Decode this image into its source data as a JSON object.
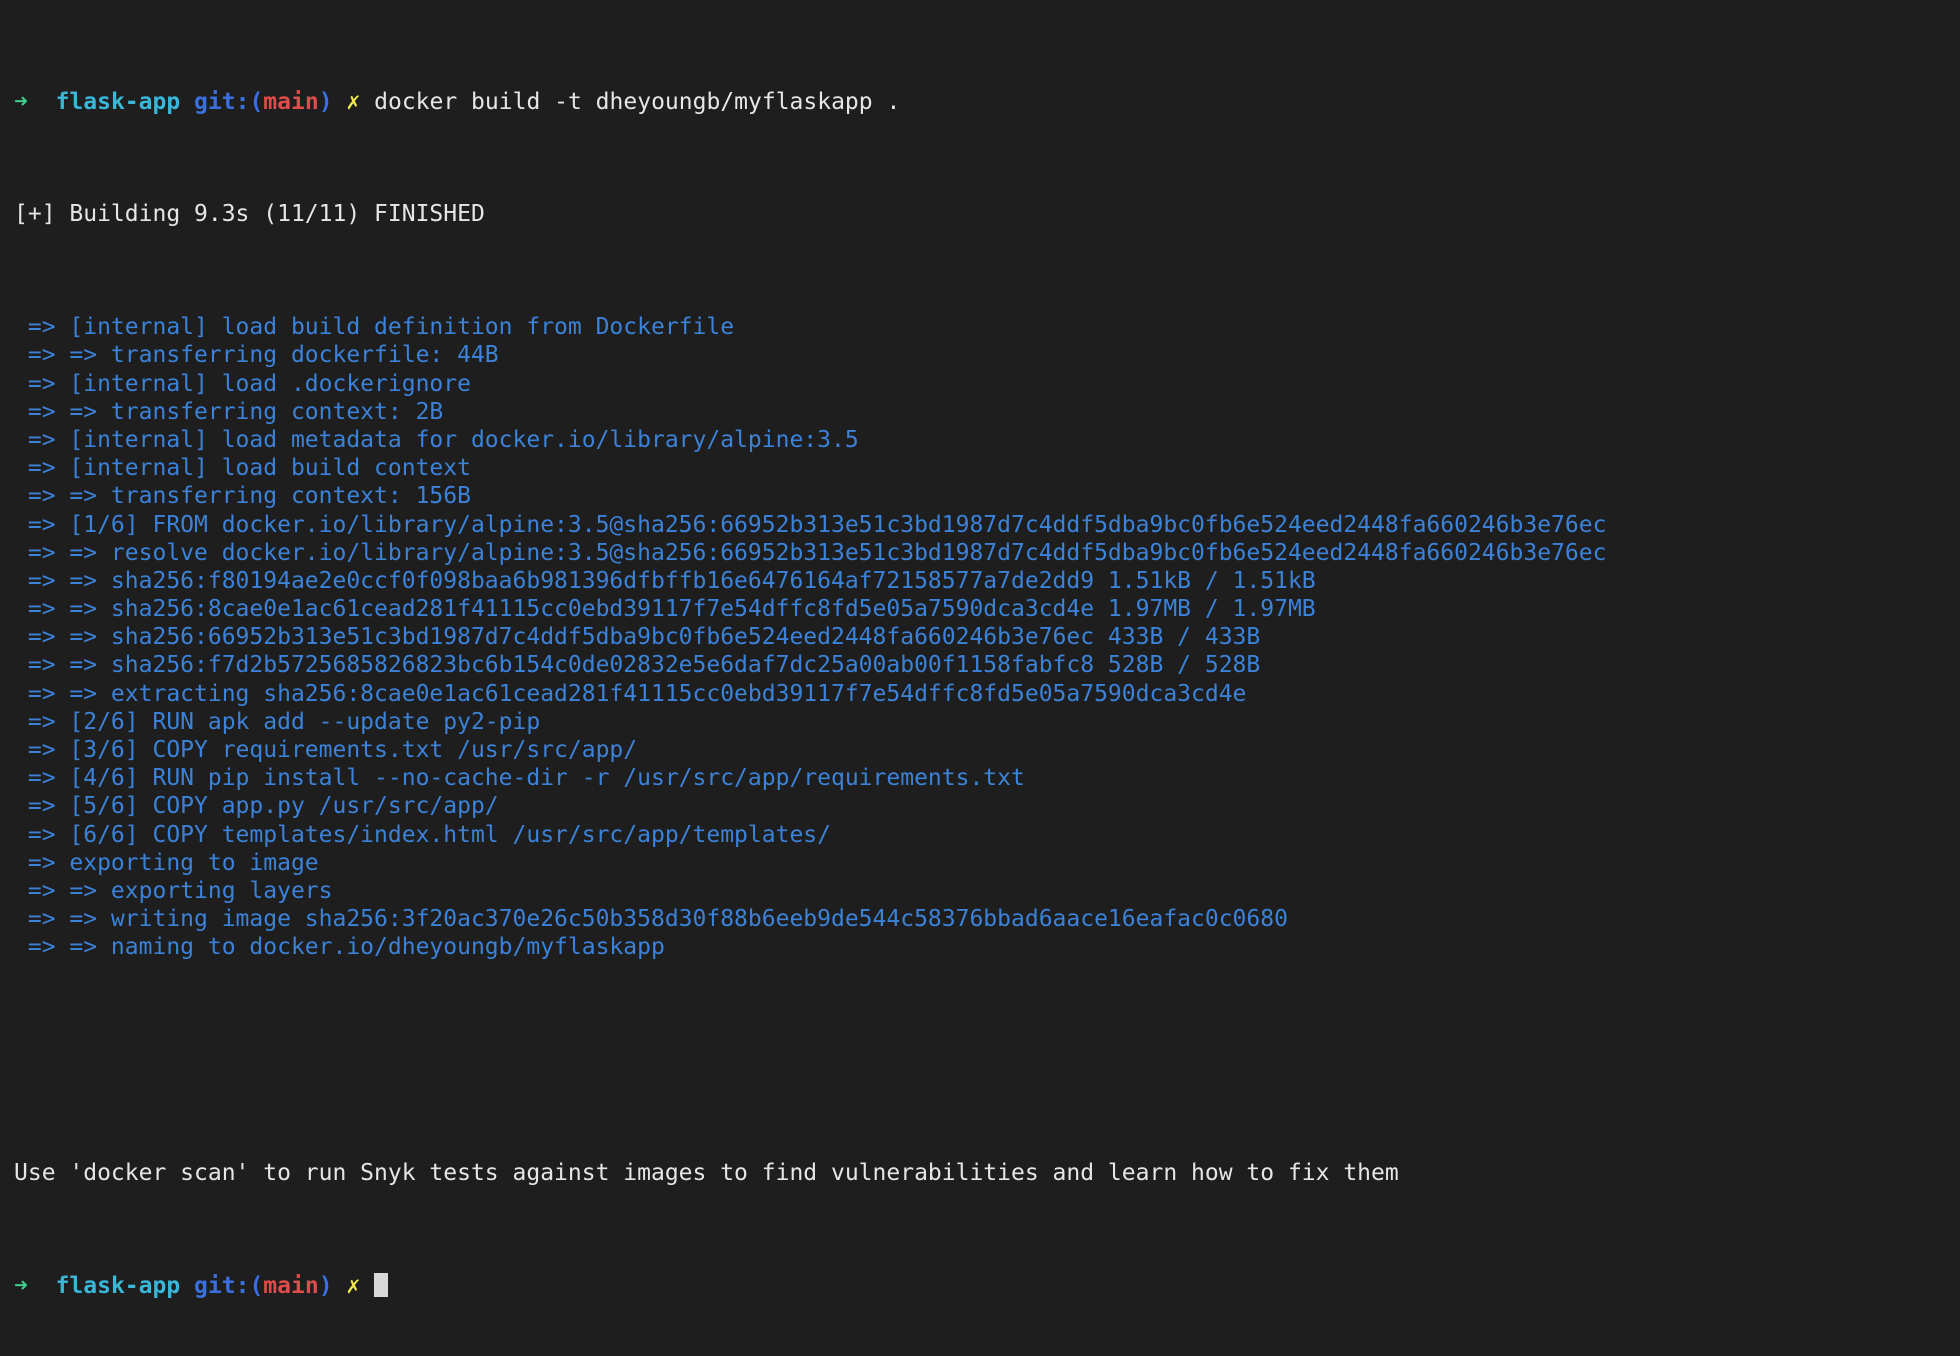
{
  "prompt": {
    "arrow": "➜",
    "dir": "flask-app",
    "git_label": "git:",
    "open_paren": "(",
    "branch": "main",
    "close_paren": ")",
    "dirty": "✗"
  },
  "command": "docker build -t dheyoungb/myflaskapp .",
  "build_header": "[+] Building 9.3s (11/11) FINISHED",
  "build_steps": [
    " => [internal] load build definition from Dockerfile",
    " => => transferring dockerfile: 44B",
    " => [internal] load .dockerignore",
    " => => transferring context: 2B",
    " => [internal] load metadata for docker.io/library/alpine:3.5",
    " => [internal] load build context",
    " => => transferring context: 156B",
    " => [1/6] FROM docker.io/library/alpine:3.5@sha256:66952b313e51c3bd1987d7c4ddf5dba9bc0fb6e524eed2448fa660246b3e76ec",
    " => => resolve docker.io/library/alpine:3.5@sha256:66952b313e51c3bd1987d7c4ddf5dba9bc0fb6e524eed2448fa660246b3e76ec",
    " => => sha256:f80194ae2e0ccf0f098baa6b981396dfbffb16e6476164af72158577a7de2dd9 1.51kB / 1.51kB",
    " => => sha256:8cae0e1ac61cead281f41115cc0ebd39117f7e54dffc8fd5e05a7590dca3cd4e 1.97MB / 1.97MB",
    " => => sha256:66952b313e51c3bd1987d7c4ddf5dba9bc0fb6e524eed2448fa660246b3e76ec 433B / 433B",
    " => => sha256:f7d2b5725685826823bc6b154c0de02832e5e6daf7dc25a00ab00f1158fabfc8 528B / 528B",
    " => => extracting sha256:8cae0e1ac61cead281f41115cc0ebd39117f7e54dffc8fd5e05a7590dca3cd4e",
    " => [2/6] RUN apk add --update py2-pip",
    " => [3/6] COPY requirements.txt /usr/src/app/",
    " => [4/6] RUN pip install --no-cache-dir -r /usr/src/app/requirements.txt",
    " => [5/6] COPY app.py /usr/src/app/",
    " => [6/6] COPY templates/index.html /usr/src/app/templates/",
    " => exporting to image",
    " => => exporting layers",
    " => => writing image sha256:3f20ac370e26c50b358d30f88b6eeb9de544c58376bbad6aace16eafac0c0680",
    " => => naming to docker.io/dheyoungb/myflaskapp"
  ],
  "scan_hint": "Use 'docker scan' to run Snyk tests against images to find vulnerabilities and learn how to fix them",
  "colors": {
    "background": "#1e1e1e",
    "step_text": "#3b82d8",
    "plain_text": "#e6e6e6",
    "prompt_arrow": "#3ecf8e",
    "prompt_dir": "#39b6d8",
    "prompt_git": "#3b6fe0",
    "prompt_branch": "#e04b4b",
    "prompt_dirty": "#f2e94e"
  }
}
